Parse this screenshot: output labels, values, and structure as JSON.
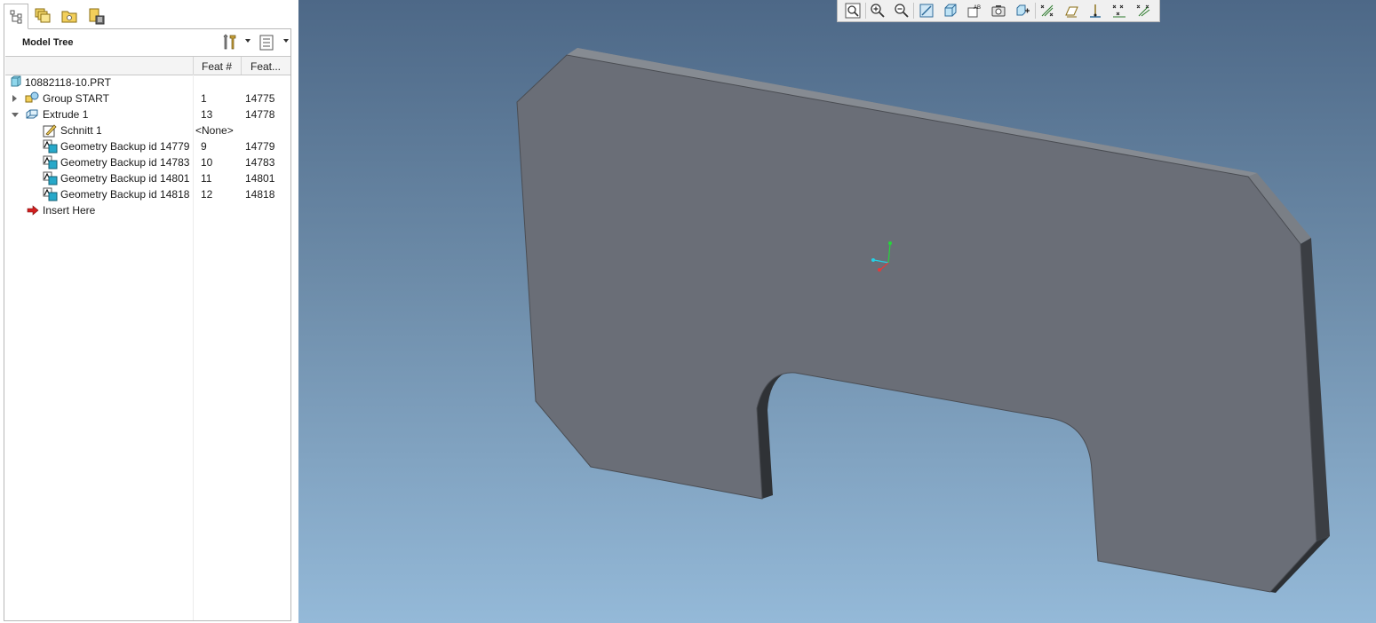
{
  "navigator": {
    "tabs": [
      "model-tree-tab",
      "layers-tab",
      "folder-browser-tab",
      "favorites-tab"
    ]
  },
  "model_tree": {
    "title": "Model Tree",
    "columns": {
      "name": "",
      "feat_num": "Feat #",
      "feat_id": "Feat..."
    },
    "rows": [
      {
        "name": "10882118-10.PRT",
        "feat_num": "",
        "feat_id": "",
        "icon": "part-icon",
        "indent": 0,
        "expander": "none"
      },
      {
        "name": "Group START",
        "feat_num": "1",
        "feat_id": "14775",
        "icon": "group-icon",
        "indent": 1,
        "expander": "collapsed"
      },
      {
        "name": "Extrude 1",
        "feat_num": "13",
        "feat_id": "14778",
        "icon": "extrude-icon",
        "indent": 1,
        "expander": "expanded"
      },
      {
        "name": "Schnitt 1",
        "feat_num": "<None>",
        "feat_id": "",
        "icon": "sketch-icon",
        "indent": 2,
        "expander": "none"
      },
      {
        "name": "Geometry Backup id 14779",
        "feat_num": "9",
        "feat_id": "14779",
        "icon": "geometry-backup-icon",
        "indent": 2,
        "expander": "none"
      },
      {
        "name": "Geometry Backup id 14783",
        "feat_num": "10",
        "feat_id": "14783",
        "icon": "geometry-backup-icon",
        "indent": 2,
        "expander": "none"
      },
      {
        "name": "Geometry Backup id 14801",
        "feat_num": "11",
        "feat_id": "14801",
        "icon": "geometry-backup-icon",
        "indent": 2,
        "expander": "none"
      },
      {
        "name": "Geometry Backup id 14818",
        "feat_num": "12",
        "feat_id": "14818",
        "icon": "geometry-backup-icon",
        "indent": 2,
        "expander": "none"
      },
      {
        "name": "Insert Here",
        "feat_num": "",
        "feat_id": "",
        "icon": "insert-arrow-icon",
        "indent": 1,
        "expander": "none"
      }
    ]
  },
  "view_toolbar": {
    "buttons": [
      "refit-icon",
      "zoom-in-icon",
      "zoom-out-icon",
      "repaint-icon",
      "display-style-icon",
      "saved-views-icon",
      "view-manager-icon",
      "spin-center-icon",
      "datum-planes-icon",
      "datum-axes-icon",
      "datum-points-icon",
      "csys-icon"
    ]
  },
  "colors": {
    "part_face": "#6a6e77",
    "part_edge_top": "#848990",
    "part_edge_side": "#3c3f44",
    "bg_top": "#4d6887",
    "bg_bottom": "#94b9d8"
  }
}
